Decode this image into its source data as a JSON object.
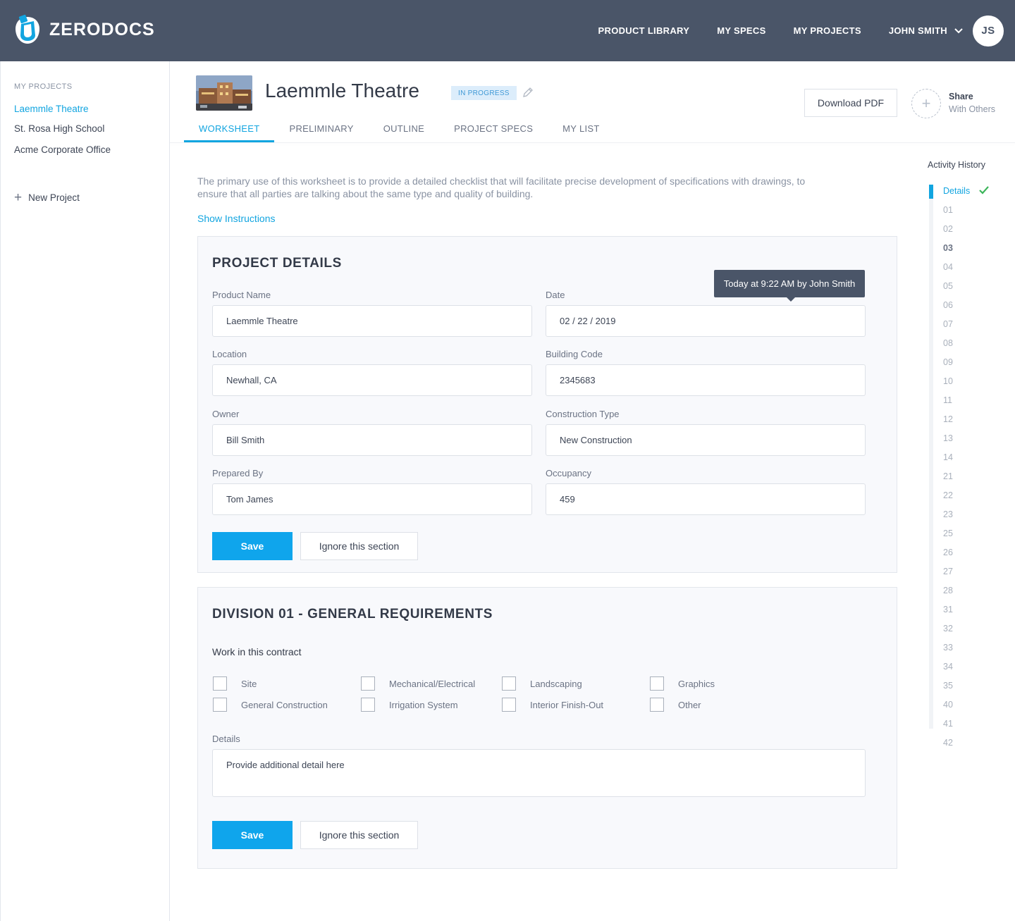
{
  "app": {
    "brand": "ZERODOCS",
    "nav": [
      "PRODUCT LIBRARY",
      "MY SPECS",
      "MY PROJECTS"
    ],
    "user_name": "JOHN SMITH",
    "user_initials": "JS"
  },
  "sidebar": {
    "heading": "MY PROJECTS",
    "projects": [
      "Laemmle Theatre",
      "St. Rosa High School",
      "Acme Corporate Office"
    ],
    "active_index": 0,
    "new_project_label": "New Project"
  },
  "project": {
    "title": "Laemmle Theatre",
    "status": "IN PROGRESS",
    "download_label": "Download PDF",
    "share_title": "Share",
    "share_sub": "With Others",
    "tabs": [
      "WORKSHEET",
      "PRELIMINARY",
      "OUTLINE",
      "PROJECT SPECS",
      "MY LIST"
    ],
    "active_tab": 0
  },
  "intro": {
    "text": "The primary use of this worksheet is to provide a detailed checklist that will facilitate precise development of specifications with drawings, to ensure that all parties are talking about the same type and quality of building.",
    "show_instructions": "Show Instructions"
  },
  "project_details": {
    "title": "PROJECT DETAILS",
    "fields": [
      {
        "label": "Product Name",
        "value": "Laemmle Theatre"
      },
      {
        "label": "Date",
        "value": "02 / 22 / 2019"
      },
      {
        "label": "Location",
        "value": "Newhall, CA"
      },
      {
        "label": "Building Code",
        "value": "2345683"
      },
      {
        "label": "Owner",
        "value": "Bill Smith"
      },
      {
        "label": "Construction Type",
        "value": "New Construction"
      },
      {
        "label": "Prepared By",
        "value": "Tom James"
      },
      {
        "label": "Occupancy",
        "value": "459"
      }
    ],
    "tooltip": "Today at 9:22 AM by John Smith",
    "save_label": "Save",
    "ignore_label": "Ignore this section"
  },
  "division01": {
    "title": "DIVISION 01 - GENERAL REQUIREMENTS",
    "subheading": "Work in this contract",
    "checkboxes": [
      "Site",
      "General Construction",
      "Mechanical/Electrical",
      "Irrigation System",
      "Landscaping",
      "Interior Finish-Out",
      "Graphics",
      "Other"
    ],
    "details_label": "Details",
    "details_placeholder": "Provide additional detail here",
    "save_label": "Save",
    "ignore_label": "Ignore this section"
  },
  "activity_history": {
    "title": "Activity History",
    "items": [
      "Details",
      "01",
      "02",
      "03",
      "04",
      "05",
      "06",
      "07",
      "08",
      "09",
      "10",
      "11",
      "12",
      "13",
      "14",
      "21",
      "22",
      "23",
      "25",
      "26",
      "27",
      "28",
      "31",
      "32",
      "33",
      "34",
      "35",
      "40",
      "41",
      "42"
    ],
    "current_index": 0,
    "bold_index": 3
  },
  "colors": {
    "accent": "#12a5e0",
    "topbar": "#4a5568",
    "save_button": "#0fa5ec",
    "check": "#3cb55a"
  }
}
